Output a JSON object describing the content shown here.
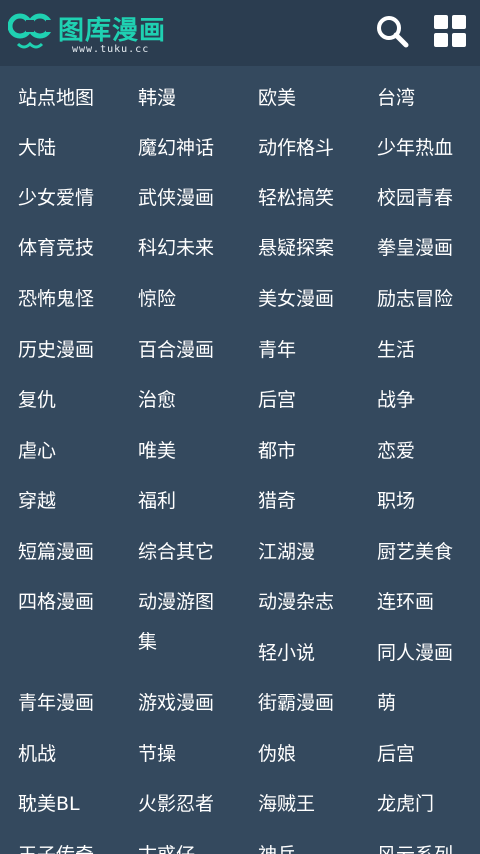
{
  "header": {
    "logo_text": "图库漫画",
    "logo_sub": "www.tuku.cc",
    "brand_color": "#1fd1b2",
    "icons": [
      "search-icon",
      "grid-menu-icon"
    ]
  },
  "categories": [
    "站点地图",
    "韩漫",
    "欧美",
    "台湾",
    "大陆",
    "魔幻神话",
    "动作格斗",
    "少年热血",
    "少女爱情",
    "武侠漫画",
    "轻松搞笑",
    "校园青春",
    "体育竞技",
    "科幻未来",
    "悬疑探案",
    "拳皇漫画",
    "恐怖鬼怪",
    "惊险",
    "美女漫画",
    "励志冒险",
    "历史漫画",
    "百合漫画",
    "青年",
    "生活",
    "复仇",
    "治愈",
    "后宫",
    "战争",
    "虐心",
    "唯美",
    "都市",
    "恋爱",
    "穿越",
    "福利",
    "猎奇",
    "职场",
    "短篇漫画",
    "综合其它",
    "江湖漫",
    "厨艺美食",
    "四格漫画",
    "动漫游图集",
    "动漫杂志",
    "连环画",
    "轻小说",
    "同人漫画",
    "青年漫画",
    "游戏漫画",
    "街霸漫画",
    "萌",
    "机战",
    "节操",
    "伪娘",
    "后宫",
    "耽美BL",
    "火影忍者",
    "海贼王",
    "龙虎门",
    "王子传奇",
    "古惑仔",
    "神兵",
    "风云系列"
  ]
}
